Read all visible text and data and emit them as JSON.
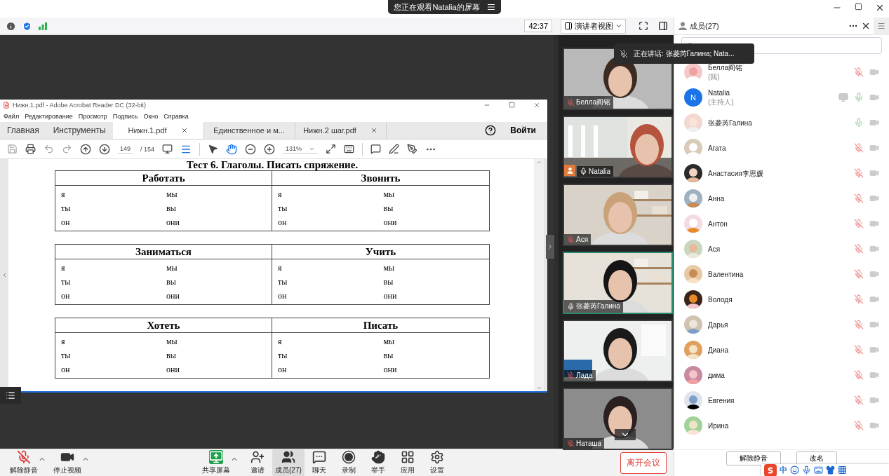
{
  "top_bar": {
    "banner": "您正在观看Natalia的屏幕"
  },
  "meeting_toolbar": {
    "timer": "42:37",
    "view_button": "演讲者视图"
  },
  "acrobat": {
    "title": "Нижн.1.pdf - Adobe Acrobat Reader DC (32-bit)",
    "menu": [
      "Файл",
      "Редактирование",
      "Просмотр",
      "Подпись",
      "Окно",
      "Справка"
    ],
    "tabs": [
      {
        "label": "Главная",
        "kind": "nav",
        "selected": false,
        "closable": false
      },
      {
        "label": "Инструменты",
        "kind": "nav",
        "selected": false,
        "closable": false
      },
      {
        "label": "Нижн.1.pdf",
        "kind": "doc",
        "selected": true,
        "closable": true
      },
      {
        "label": "Единственное и м...",
        "kind": "doc",
        "selected": false,
        "closable": false
      },
      {
        "label": "Нижн.2 шаг.pdf",
        "kind": "doc",
        "selected": false,
        "closable": true
      }
    ],
    "sign_in": "Войти",
    "page": "149",
    "page_total": "/ 154",
    "zoom": "131%",
    "document": {
      "title": "Тест 6. Глаголы. Писать спряжение.",
      "tables": [
        {
          "verbs": [
            "Работать",
            "Звонить"
          ],
          "rows": [
            [
              "я",
              "мы",
              "я",
              "мы"
            ],
            [
              "ты",
              "вы",
              "ты",
              "вы"
            ],
            [
              "он",
              "они",
              "он",
              "они"
            ]
          ]
        },
        {
          "verbs": [
            "Заниматься",
            "Учить"
          ],
          "rows": [
            [
              "я",
              "мы",
              "я",
              "мы"
            ],
            [
              "ты",
              "вы",
              "ты",
              "вы"
            ],
            [
              "он",
              "они",
              "он",
              "они"
            ]
          ]
        },
        {
          "verbs": [
            "Хотеть",
            "Писать"
          ],
          "rows": [
            [
              "я",
              "мы",
              "я",
              "мы"
            ],
            [
              "ты",
              "вы",
              "ты",
              "вы"
            ],
            [
              "он",
              "они",
              "он",
              "они"
            ]
          ]
        }
      ]
    }
  },
  "videos": [
    {
      "name": "Белла阎铭",
      "muted": true,
      "active": false,
      "presenter": false
    },
    {
      "name": "Natalia",
      "muted": false,
      "active": false,
      "presenter": true
    },
    {
      "name": "Ася",
      "muted": true,
      "active": false,
      "presenter": false
    },
    {
      "name": "张菱芮Галина",
      "muted": false,
      "active": true,
      "presenter": false
    },
    {
      "name": "Лада",
      "muted": true,
      "active": false,
      "presenter": false
    },
    {
      "name": "Наташа",
      "muted": true,
      "active": false,
      "presenter": false
    }
  ],
  "speaking_tooltip": "正在讲话: 张菱芮Галина; Nata...",
  "members_panel": {
    "title": "成员(27)",
    "members": [
      {
        "name": "Белла阎铭",
        "note": "(我)",
        "muted": true,
        "sharing": false
      },
      {
        "name": "Natalia",
        "note": "(主持人)",
        "avatar_letter": "N",
        "muted": false,
        "sharing": true
      },
      {
        "name": "张菱芮Галина",
        "muted": false,
        "sharing": false
      },
      {
        "name": "Агата",
        "muted": true,
        "sharing": false
      },
      {
        "name": "Анастасия李思媛",
        "muted": true,
        "sharing": false
      },
      {
        "name": "Анна",
        "muted": true,
        "sharing": false
      },
      {
        "name": "Антон",
        "muted": true,
        "sharing": false
      },
      {
        "name": "Ася",
        "muted": true,
        "sharing": false
      },
      {
        "name": "Валентина",
        "muted": true,
        "sharing": false
      },
      {
        "name": "Володя",
        "muted": true,
        "sharing": false
      },
      {
        "name": "Дарья",
        "muted": true,
        "sharing": false
      },
      {
        "name": "Диана",
        "muted": true,
        "sharing": false
      },
      {
        "name": "дима",
        "muted": true,
        "sharing": false
      },
      {
        "name": "Евгения",
        "muted": true,
        "sharing": false
      },
      {
        "name": "Ирина",
        "muted": true,
        "sharing": false
      }
    ],
    "buttons": [
      "解除静音",
      "改名"
    ]
  },
  "bottom_toolbar": {
    "items": [
      {
        "label": "解除静音",
        "kind": "mic",
        "caret": true,
        "selected": false
      },
      {
        "label": "停止视频",
        "kind": "video",
        "caret": true,
        "selected": false
      },
      {
        "label": "共享屏幕",
        "kind": "share",
        "caret": true,
        "selected": false
      },
      {
        "label": "邀请",
        "kind": "invite",
        "caret": false,
        "selected": false
      },
      {
        "label": "成员(27)",
        "kind": "members",
        "caret": false,
        "selected": true
      },
      {
        "label": "聊天",
        "kind": "chat",
        "caret": false,
        "selected": false
      },
      {
        "label": "录制",
        "kind": "record",
        "caret": false,
        "selected": false
      },
      {
        "label": "举手",
        "kind": "hand",
        "caret": false,
        "selected": false
      },
      {
        "label": "应用",
        "kind": "apps",
        "caret": false,
        "selected": false
      },
      {
        "label": "设置",
        "kind": "settings",
        "caret": false,
        "selected": false
      }
    ],
    "leave": "离开会议"
  },
  "ime_bar": {
    "label": "中"
  }
}
